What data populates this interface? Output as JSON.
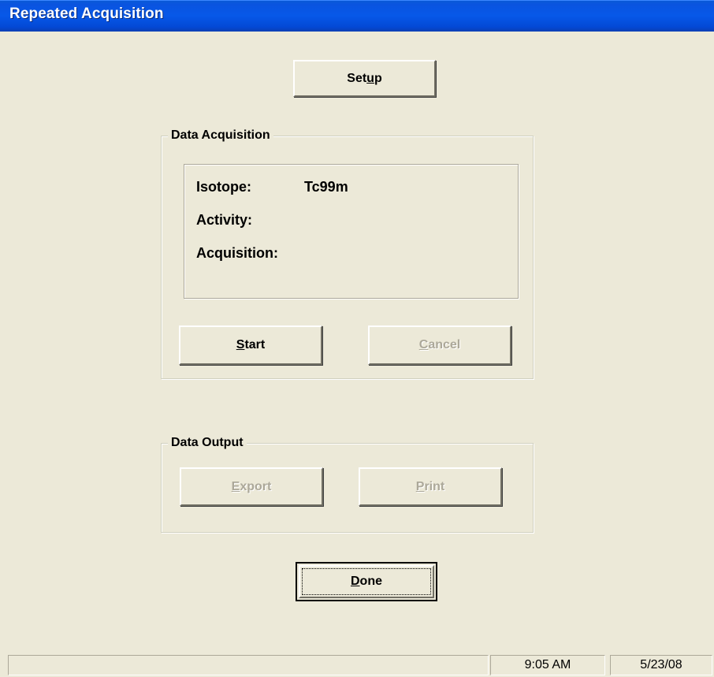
{
  "window": {
    "title": "Repeated Acquisition"
  },
  "buttons": {
    "setup": {
      "pre": "Set",
      "mnemonic": "u",
      "post": "p"
    },
    "start": {
      "pre": "",
      "mnemonic": "S",
      "post": "tart"
    },
    "cancel": {
      "pre": "",
      "mnemonic": "C",
      "post": "ancel"
    },
    "export": {
      "pre": "",
      "mnemonic": "E",
      "post": "xport"
    },
    "print": {
      "pre": "",
      "mnemonic": "P",
      "post": "rint"
    },
    "done": {
      "pre": "",
      "mnemonic": "D",
      "post": "one"
    }
  },
  "data_acquisition": {
    "legend": "Data Acquisition",
    "isotope_label": "Isotope:",
    "isotope_value": "Tc99m",
    "activity_label": "Activity:",
    "acquisition_label": "Acquisition:"
  },
  "data_output": {
    "legend": "Data Output"
  },
  "statusbar": {
    "message": "",
    "time": "9:05 AM",
    "date": "5/23/08"
  },
  "colors": {
    "titlebar": "#0a54e0",
    "dialog_bg": "#ece9d8",
    "disabled_text": "#aca899"
  }
}
